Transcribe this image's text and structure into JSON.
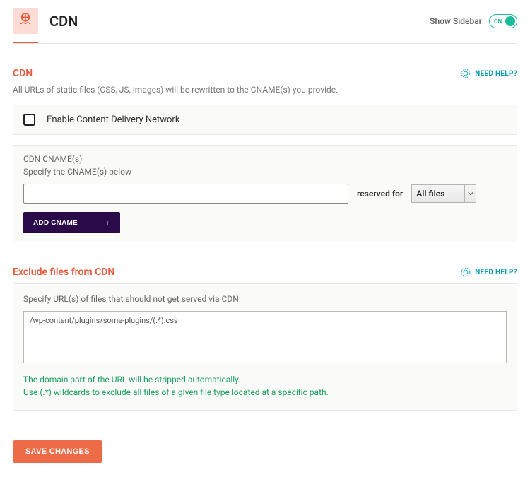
{
  "header": {
    "title": "CDN",
    "show_sidebar_label": "Show Sidebar",
    "toggle_label": "ON"
  },
  "help_label": "NEED HELP?",
  "cdn_section": {
    "title": "CDN",
    "desc": "All URLs of static files (CSS, JS, images) will be rewritten to the CNAME(s) you provide.",
    "enable_label": "Enable Content Delivery Network",
    "cname_label": "CDN CNAME(s)",
    "cname_sublabel": "Specify the CNAME(s) below",
    "cname_value": "",
    "reserved_label": "reserved for",
    "select_value": "All files",
    "add_cname_label": "ADD CNAME"
  },
  "exclude_section": {
    "title": "Exclude files from CDN",
    "desc": "Specify URL(s) of files that should not get served via CDN",
    "textarea_value": "/wp-content/plugins/some-plugins/(.*).css",
    "hint_line1": "The domain part of the URL will be stripped automatically.",
    "hint_line2": "Use (.*) wildcards to exclude all files of a given file type located at a specific path."
  },
  "save_label": "SAVE CHANGES"
}
